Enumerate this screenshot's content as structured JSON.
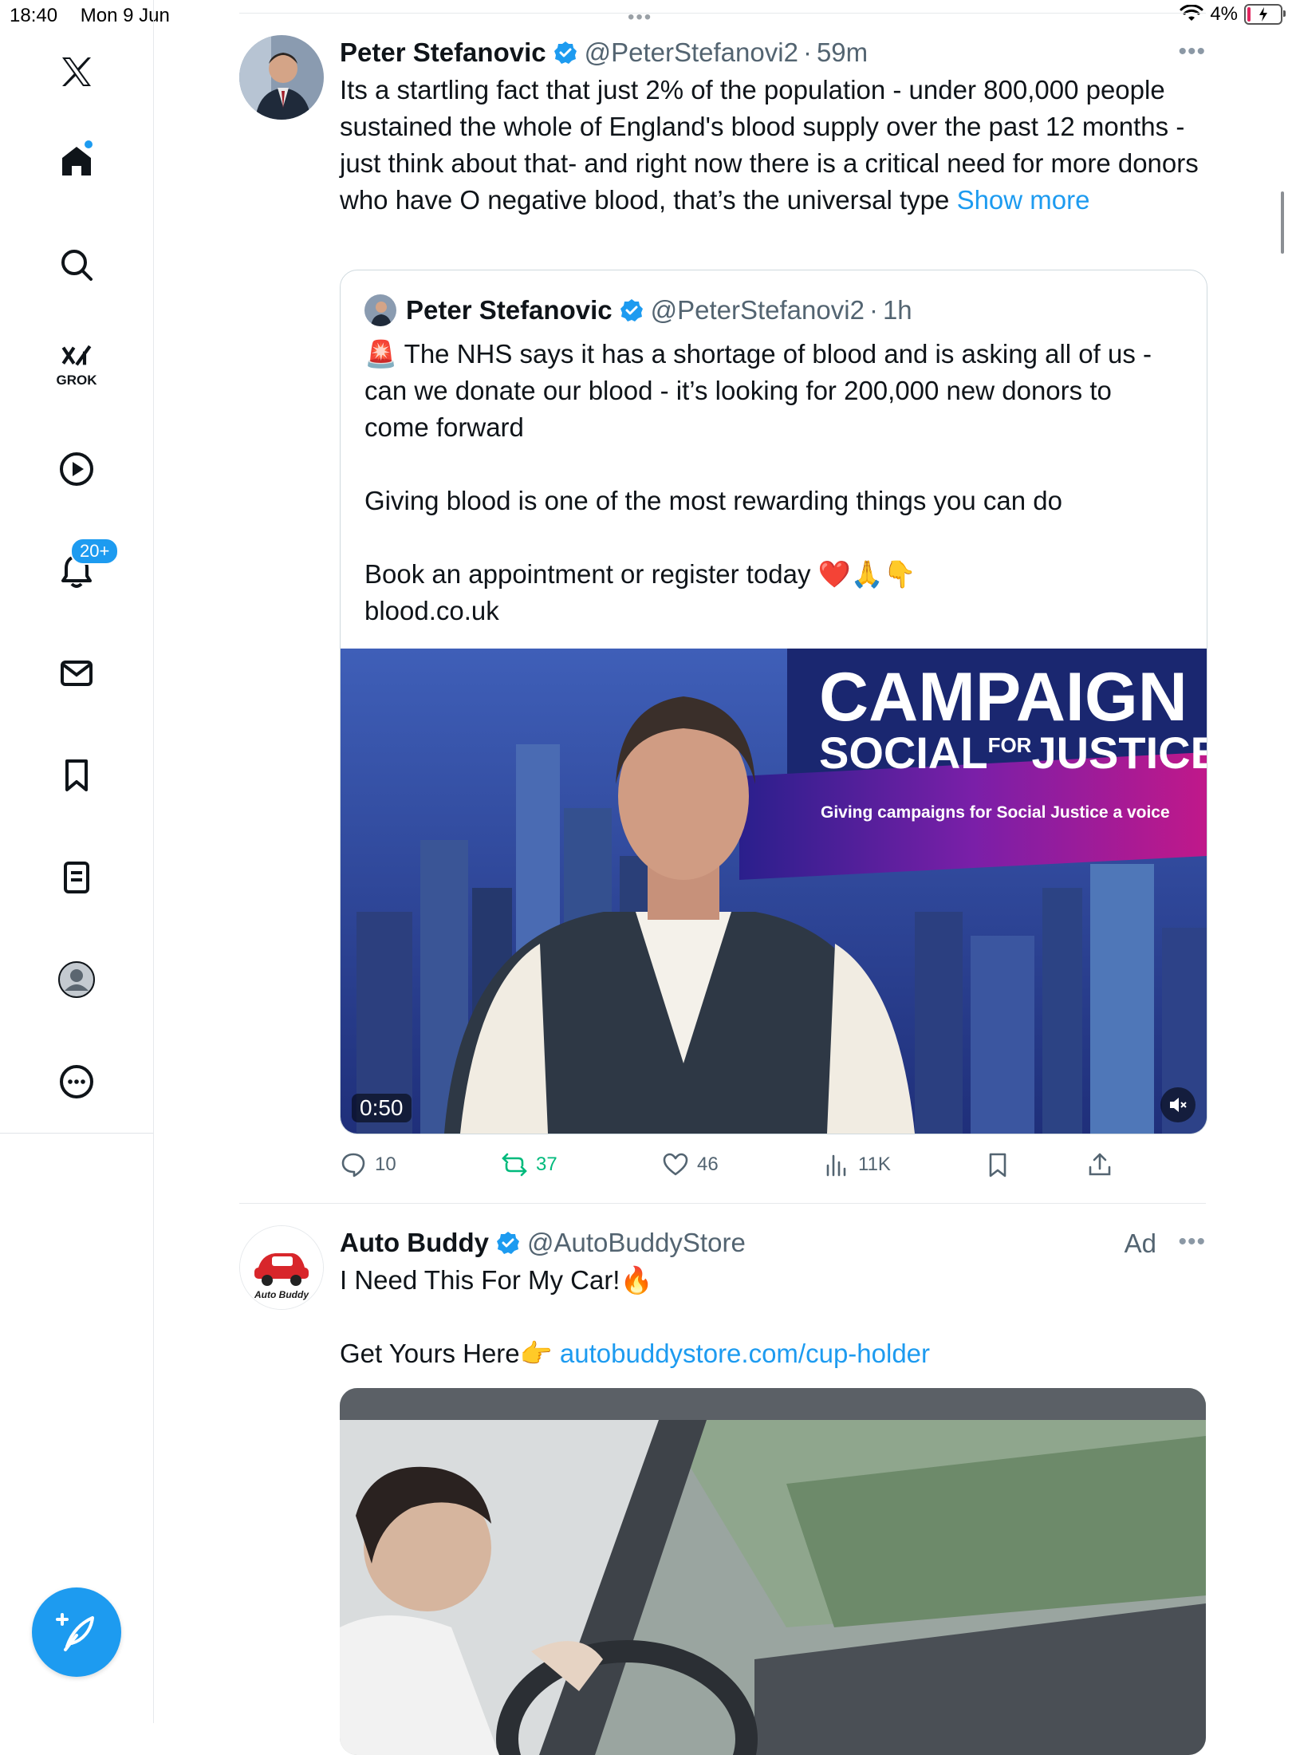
{
  "status_bar": {
    "time": "18:40",
    "date": "Mon 9 Jun",
    "battery": "4%"
  },
  "sidebar": {
    "grok_label": "GROK",
    "notifications_badge": "20+"
  },
  "tweet1": {
    "name": "Peter Stefanovic",
    "handle": "@PeterStefanovi2",
    "time": "59m",
    "text": "Its a startling fact that just 2% of the population - under 800,000 people sustained the whole of England's blood supply over the past 12 months - just think about that- and right now there is a critical need for more donors who have O negative blood, that’s the universal type ",
    "show_more": "Show more",
    "quote": {
      "name": "Peter Stefanovic",
      "handle": "@PeterStefanovi2",
      "time": "1h",
      "text": "🚨 The NHS says it has a shortage of blood and is asking all of us - can we donate our blood - it’s looking for 200,000 new donors to come forward\n\nGiving blood is one of the most rewarding things you can do\n\nBook an appointment or register today ❤️🙏👇\nblood.co.uk",
      "video": {
        "duration": "0:50",
        "banner_title": "CAMPAIGN",
        "banner_sub_left": "SOCIAL",
        "banner_sub_for": "FOR",
        "banner_sub_right": "JUSTICE",
        "banner_tagline": "Giving campaigns for Social Justice a voice"
      }
    },
    "stats": {
      "replies": "10",
      "reposts": "37",
      "likes": "46",
      "views": "11K"
    }
  },
  "tweet2": {
    "name": "Auto Buddy",
    "handle": "@AutoBuddyStore",
    "ad_label": "Ad",
    "text_line1": "I Need This For My Car!🔥",
    "text_line2": "Get Yours Here👉 ",
    "link": "autobuddystore.com/cup-holder",
    "avatar_caption": "Auto Buddy"
  },
  "colors": {
    "accent": "#1d9bf0",
    "repost_green": "#00ba7c",
    "text": "#0f1419",
    "muted": "#536471"
  }
}
